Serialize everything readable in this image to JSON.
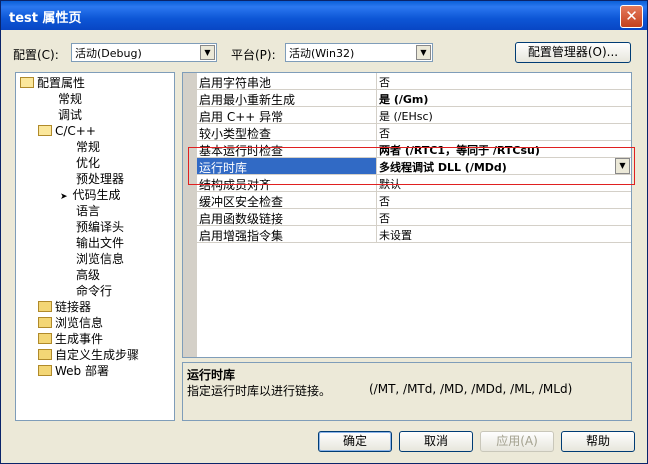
{
  "window": {
    "title": "test 属性页",
    "close_glyph": "✕"
  },
  "toolbar": {
    "config_label": "配置(C):",
    "config_value": "活动(Debug)",
    "platform_label": "平台(P):",
    "platform_value": "活动(Win32)",
    "config_manager_label": "配置管理器(O)..."
  },
  "tree": {
    "items": [
      {
        "label": "配置属性",
        "icon": "folder-open-icon"
      },
      {
        "label": "常规"
      },
      {
        "label": "调试"
      },
      {
        "label": "C/C++",
        "icon": "folder-open-icon"
      },
      {
        "label": "常规"
      },
      {
        "label": "优化"
      },
      {
        "label": "预处理器"
      },
      {
        "label": "代码生成",
        "marker": "➤"
      },
      {
        "label": "语言"
      },
      {
        "label": "预编译头"
      },
      {
        "label": "输出文件"
      },
      {
        "label": "浏览信息"
      },
      {
        "label": "高级"
      },
      {
        "label": "命令行"
      },
      {
        "label": "链接器",
        "icon": "folder-icon"
      },
      {
        "label": "浏览信息",
        "icon": "folder-icon"
      },
      {
        "label": "生成事件",
        "icon": "folder-icon"
      },
      {
        "label": "自定义生成步骤",
        "icon": "folder-icon"
      },
      {
        "label": "Web 部署",
        "icon": "folder-icon"
      }
    ]
  },
  "properties": {
    "rows": [
      {
        "name": "启用字符串池",
        "value": "否"
      },
      {
        "name": "启用最小重新生成",
        "value": "是 (/Gm)",
        "bold": true
      },
      {
        "name": "启用 C++ 异常",
        "value": "是 (/EHsc)"
      },
      {
        "name": "较小类型检查",
        "value": "否"
      },
      {
        "name": "基本运行时检查",
        "value": "两者 (/RTC1，等同于 /RTCsu)",
        "bold": true
      },
      {
        "name": "运行时库",
        "value": "多线程调试 DLL (/MDd)",
        "selected": true
      },
      {
        "name": "结构成员对齐",
        "value": "默认"
      },
      {
        "name": "缓冲区安全检查",
        "value": "否"
      },
      {
        "name": "启用函数级链接",
        "value": "否"
      },
      {
        "name": "启用增强指令集",
        "value": "未设置"
      }
    ]
  },
  "description": {
    "title": "运行时库",
    "text": "指定运行时库以进行链接。",
    "options": "(/MT, /MTd, /MD, /MDd, /ML, /MLd)"
  },
  "buttons": {
    "ok": "确定",
    "cancel": "取消",
    "apply": "应用(A)",
    "help": "帮助"
  },
  "colors": {
    "selection": "#316ac5",
    "highlight_box": "#e02020"
  }
}
